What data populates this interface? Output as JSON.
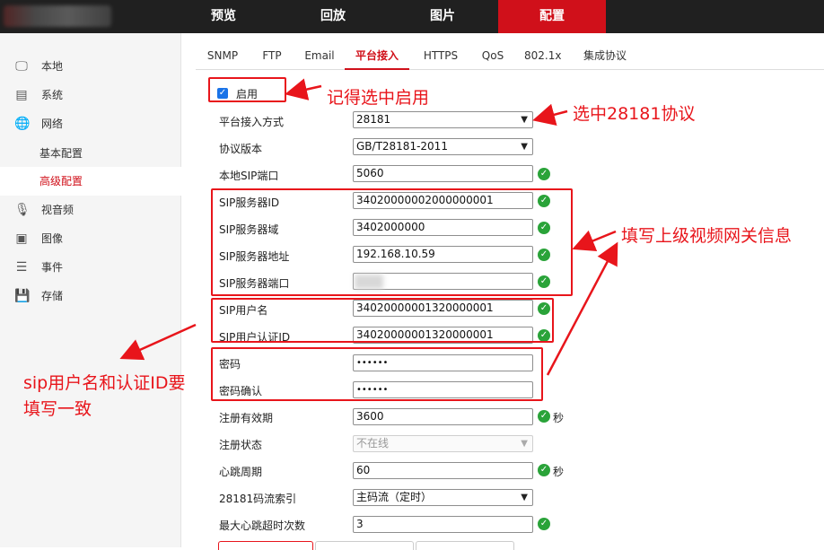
{
  "top_nav": [
    "预览",
    "回放",
    "图片",
    "配置"
  ],
  "sidebar": {
    "items": [
      {
        "label": "本地",
        "icon": "monitor-icon"
      },
      {
        "label": "系统",
        "icon": "system-icon"
      },
      {
        "label": "网络",
        "icon": "globe-icon"
      },
      {
        "label": "基本配置"
      },
      {
        "label": "高级配置"
      },
      {
        "label": "视音频",
        "icon": "audio-video-icon"
      },
      {
        "label": "图像",
        "icon": "image-icon"
      },
      {
        "label": "事件",
        "icon": "event-icon"
      },
      {
        "label": "存储",
        "icon": "storage-icon"
      }
    ]
  },
  "tabs": [
    "SNMP",
    "FTP",
    "Email",
    "平台接入",
    "HTTPS",
    "QoS",
    "802.1x",
    "集成协议"
  ],
  "form": {
    "enable_label": "启用",
    "access_mode_label": "平台接入方式",
    "access_mode_value": "28181",
    "protocol_version_label": "协议版本",
    "protocol_version_value": "GB/T28181-2011",
    "local_sip_port_label": "本地SIP端口",
    "local_sip_port_value": "5060",
    "sip_server_id_label": "SIP服务器ID",
    "sip_server_id_value": "34020000002000000001",
    "sip_server_domain_label": "SIP服务器域",
    "sip_server_domain_value": "3402000000",
    "sip_server_addr_label": "SIP服务器地址",
    "sip_server_addr_value": "192.168.10.59",
    "sip_server_port_label": "SIP服务器端口",
    "sip_username_label": "SIP用户名",
    "sip_username_value": "34020000001320000001",
    "sip_auth_id_label": "SIP用户认证ID",
    "sip_auth_id_value": "34020000001320000001",
    "password_label": "密码",
    "password_value": "••••••",
    "password_confirm_label": "密码确认",
    "password_confirm_value": "••••••",
    "reg_validity_label": "注册有效期",
    "reg_validity_value": "3600",
    "reg_status_label": "注册状态",
    "reg_status_value": "不在线",
    "heartbeat_label": "心跳周期",
    "heartbeat_value": "60",
    "stream_index_label": "28181码流索引",
    "stream_index_value": "主码流（定时）",
    "max_heartbeat_timeout_label": "最大心跳超时次数",
    "max_heartbeat_timeout_value": "3",
    "unit_seconds": "秒"
  },
  "annotations": {
    "check_enable": "记得选中启用",
    "select_28181": "选中28181协议",
    "fill_gateway": "填写上级视频网关信息",
    "sip_same_line1": "sip用户名和认证ID要",
    "sip_same_line2": "填写一致"
  },
  "colors": {
    "accent": "#d0101a",
    "annotation": "#e8151b",
    "ok": "#2aa339",
    "topbar": "#202020"
  }
}
